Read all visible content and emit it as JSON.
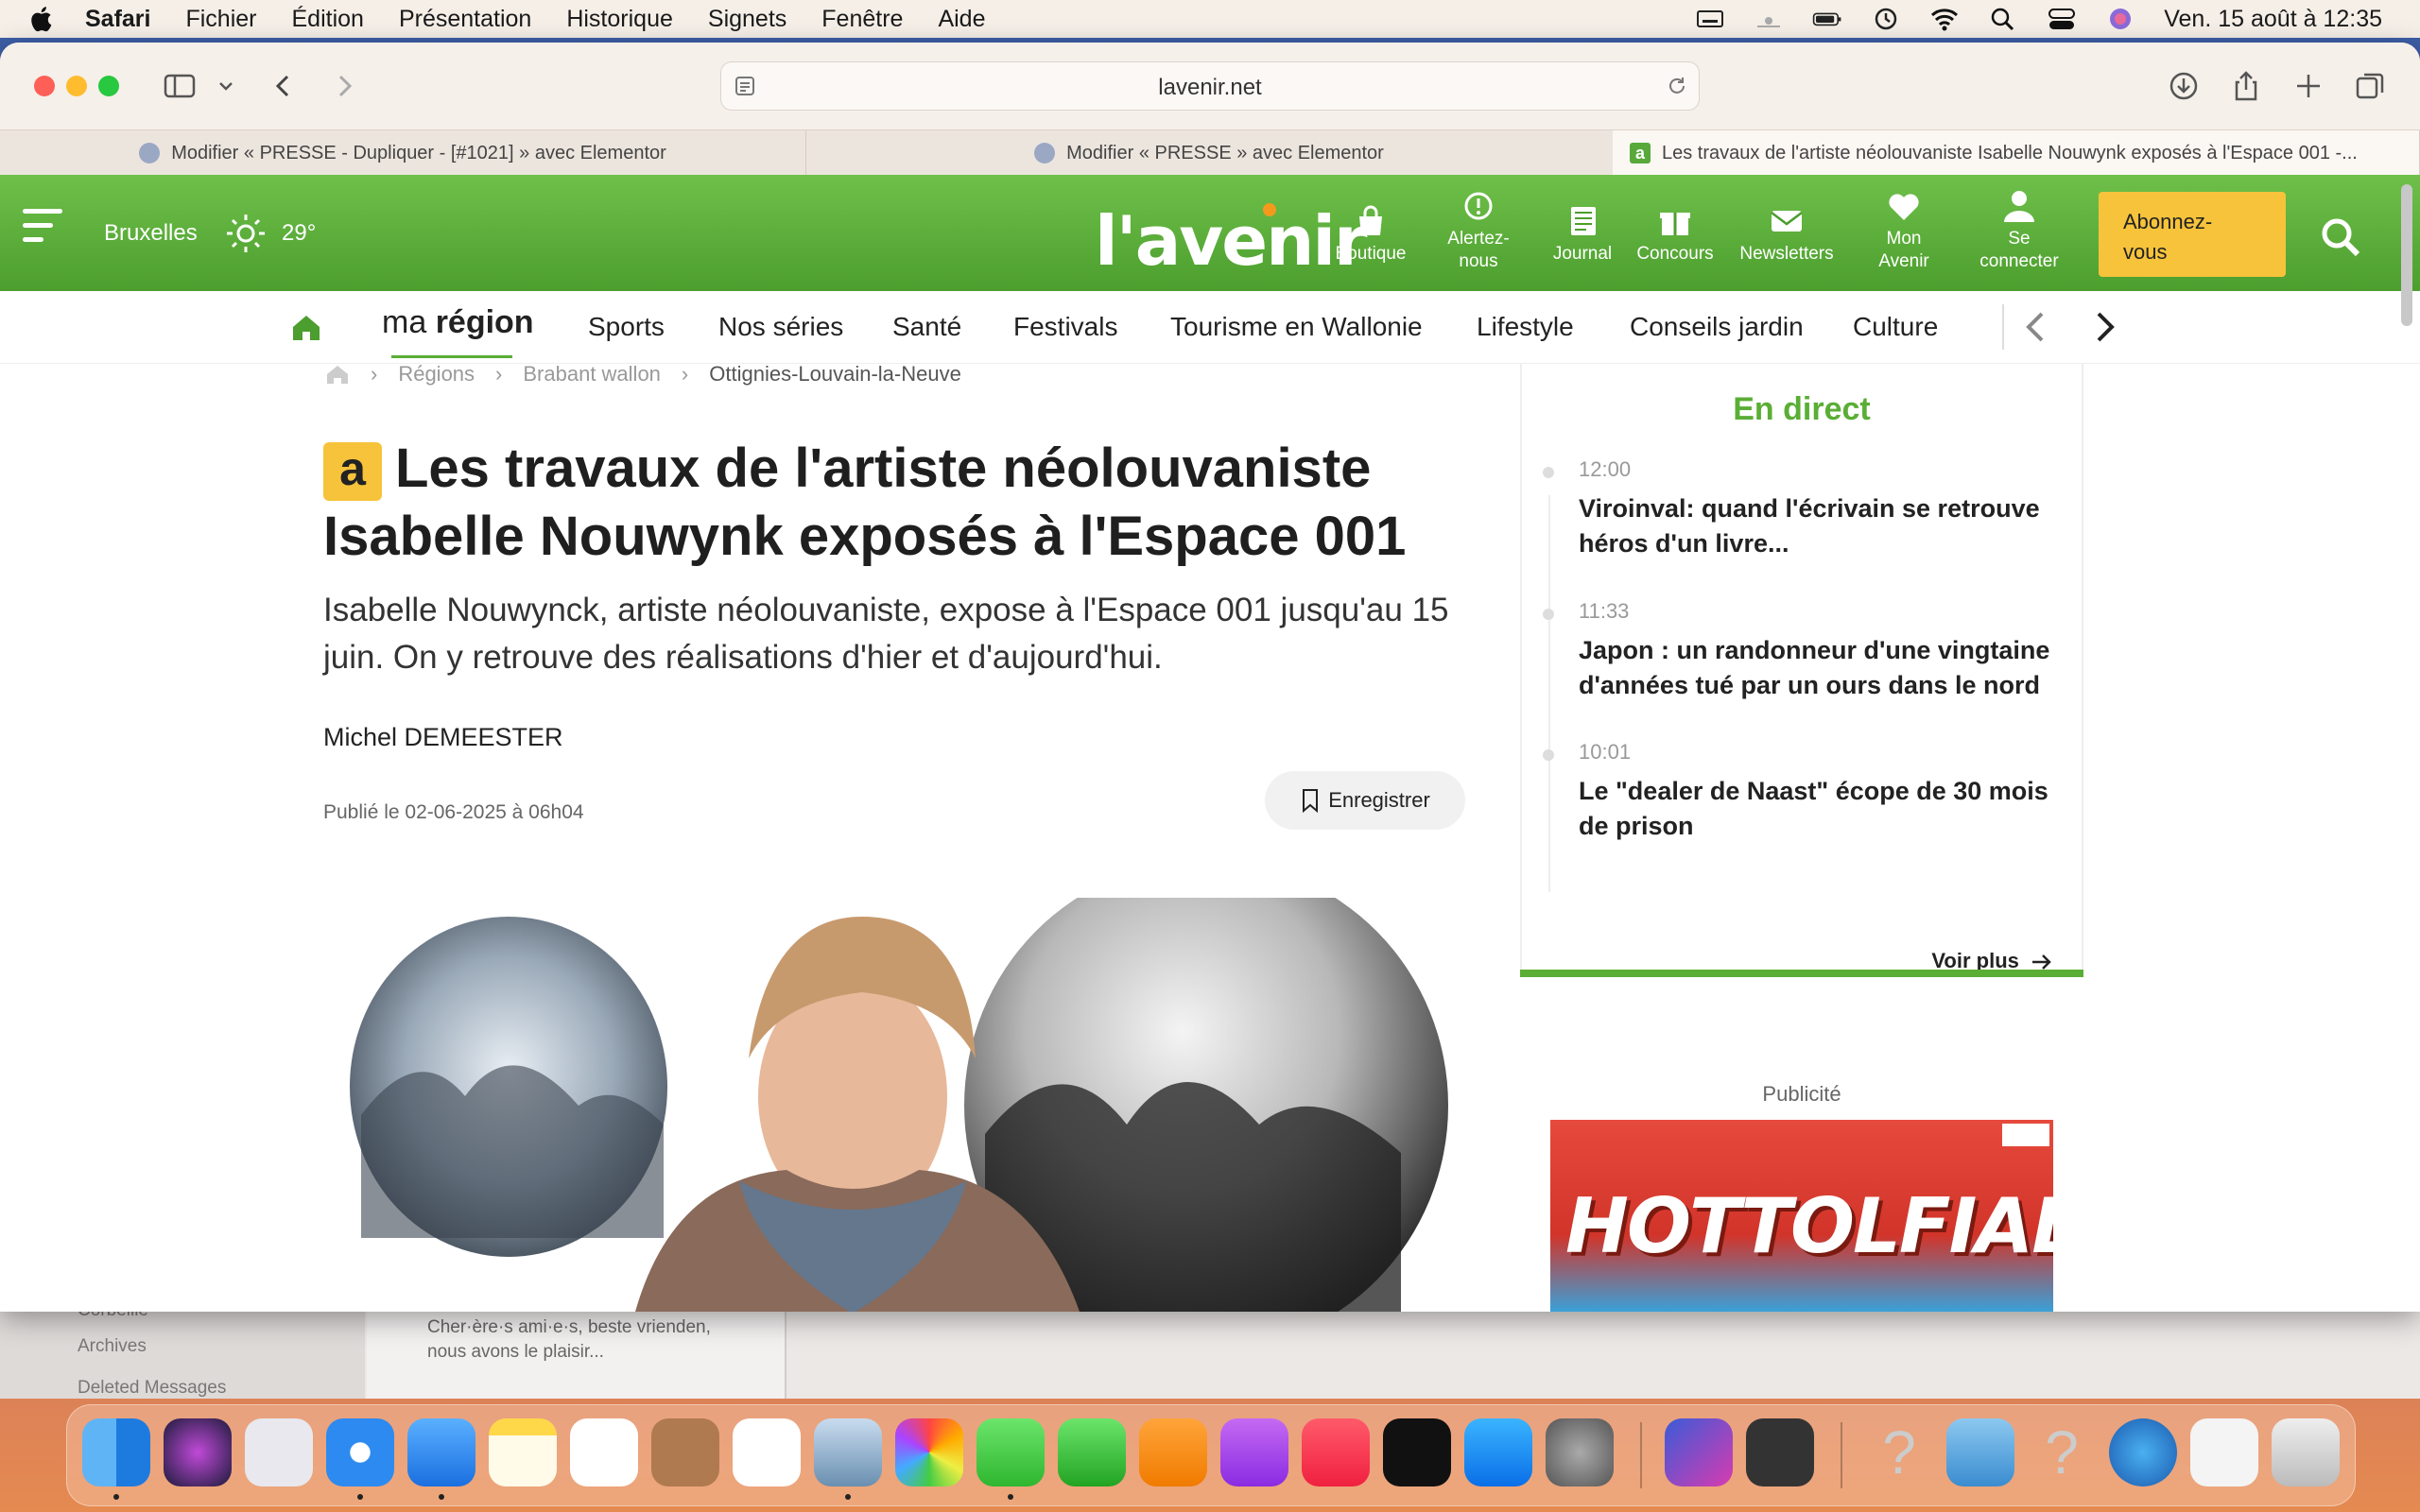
{
  "menubar": {
    "app": "Safari",
    "items": [
      "Fichier",
      "Édition",
      "Présentation",
      "Historique",
      "Signets",
      "Fenêtre",
      "Aide"
    ],
    "clock": "Ven. 15 août à 12:35"
  },
  "browser": {
    "url": "lavenir.net",
    "tabs": [
      "Modifier « PRESSE - Dupliquer - [#1021] » avec Elementor",
      "Modifier « PRESSE » avec Elementor",
      "Les travaux de l'artiste néolouvaniste Isabelle Nouwynk exposés à l'Espace 001 -..."
    ],
    "tab_favicons": [
      "001",
      "001",
      "a"
    ]
  },
  "site": {
    "city": "Bruxelles",
    "temp": "29°",
    "logo": "l'avenir",
    "header_items": [
      {
        "label": "Boutique",
        "icon": "bag-icon"
      },
      {
        "label": "Alertez-nous",
        "icon": "alert-icon"
      },
      {
        "label": "Journal",
        "icon": "newspaper-icon"
      },
      {
        "label": "Concours",
        "icon": "gift-icon"
      },
      {
        "label": "Newsletters",
        "icon": "mail-icon"
      },
      {
        "label": "Mon Avenir",
        "icon": "heart-icon"
      },
      {
        "label": "Se connecter",
        "icon": "user-icon"
      }
    ],
    "subscribe": "Abonnez-vous",
    "nav": {
      "region_prefix": "ma",
      "region_main": "région",
      "items": [
        "Sports",
        "Nos séries",
        "Santé",
        "Festivals",
        "Tourisme en Wallonie",
        "Lifestyle",
        "Conseils jardin",
        "Culture"
      ]
    },
    "breadcrumbs": [
      "Régions",
      "Brabant wallon",
      "Ottignies-Louvain-la-Neuve"
    ]
  },
  "article": {
    "badge": "a",
    "title": "Les travaux de l'artiste néolouvaniste Isabelle Nouwynk exposés à l'Espace 001",
    "chapo": "Isabelle Nouwynck, artiste néolouvaniste, expose à l'Espace 001 jusqu'au 15 juin. On y retrouve des réalisations d'hier et d'aujourd'hui.",
    "author": "Michel DEMEESTER",
    "published": "Publié le 02-06-2025 à 06h04",
    "save_label": "Enregistrer"
  },
  "live": {
    "heading": "En direct",
    "items": [
      {
        "time": "12:00",
        "text": "Viroinval: quand l'écrivain se retrouve héros d'un livre..."
      },
      {
        "time": "11:33",
        "text": "Japon : un randonneur d'une vingtaine d'années tué par un ours dans le nord"
      },
      {
        "time": "10:01",
        "text": "Le \"dealer de Naast\" écope de 30 mois de prison"
      }
    ],
    "more": "Voir plus"
  },
  "ad": {
    "label": "Publicité",
    "text": "HOTTOLFIADES"
  },
  "mail": {
    "sidebar": [
      "Corbeille",
      "Archives",
      "Deleted Messages"
    ],
    "preview": "Cher·ère·s ami·e·s, beste vrienden, nous avons le plaisir..."
  }
}
